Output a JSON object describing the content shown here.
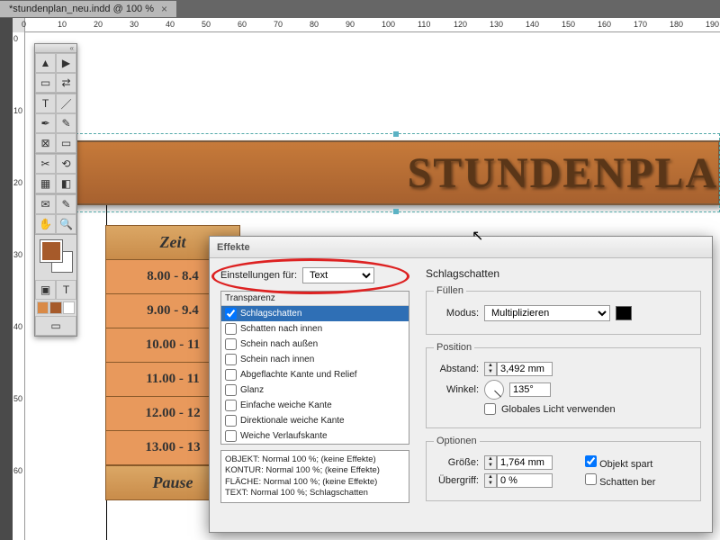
{
  "tab": {
    "title": "*stundenplan_neu.indd @ 100 %",
    "close": "×"
  },
  "ruler_top": [
    "0",
    "10",
    "20",
    "30",
    "40",
    "50",
    "60",
    "70",
    "80",
    "90",
    "100",
    "110",
    "120",
    "130",
    "140",
    "150",
    "160",
    "170",
    "180",
    "190"
  ],
  "ruler_left": [
    "0",
    "10",
    "20",
    "30",
    "40",
    "50",
    "60"
  ],
  "banner_text": "STUNDENPLA",
  "schedule": {
    "header": "Zeit",
    "rows": [
      "8.00 - 8.4",
      "9.00 - 9.4",
      "10.00 - 11",
      "11.00 - 11",
      "12.00 - 12",
      "13.00 - 13"
    ],
    "pause": "Pause"
  },
  "dialog": {
    "title": "Effekte",
    "settings_for_label": "Einstellungen für:",
    "settings_for_value": "Text",
    "list_header": "Transparenz",
    "list": [
      {
        "label": "Schlagschatten",
        "checked": true,
        "selected": true
      },
      {
        "label": "Schatten nach innen",
        "checked": false
      },
      {
        "label": "Schein nach außen",
        "checked": false
      },
      {
        "label": "Schein nach innen",
        "checked": false
      },
      {
        "label": "Abgeflachte Kante und Relief",
        "checked": false
      },
      {
        "label": "Glanz",
        "checked": false
      },
      {
        "label": "Einfache weiche Kante",
        "checked": false
      },
      {
        "label": "Direktionale weiche Kante",
        "checked": false
      },
      {
        "label": "Weiche Verlaufskante",
        "checked": false
      }
    ],
    "summary": [
      "OBJEKT: Normal 100 %; (keine Effekte)",
      "KONTUR: Normal 100 %; (keine Effekte)",
      "FLÄCHE: Normal 100 %; (keine Effekte)",
      "TEXT: Normal 100 %; Schlagschatten"
    ],
    "drop_shadow_title": "Schlagschatten",
    "blend": {
      "legend": "Füllen",
      "mode_label": "Modus:",
      "mode_value": "Multiplizieren"
    },
    "position": {
      "legend": "Position",
      "distance_label": "Abstand:",
      "distance_value": "3,492 mm",
      "angle_label": "Winkel:",
      "angle_value": "135°",
      "global_light": "Globales Licht verwenden"
    },
    "options": {
      "legend": "Optionen",
      "size_label": "Größe:",
      "size_value": "1,764 mm",
      "spread_label": "Übergriff:",
      "spread_value": "0 %",
      "obj_spart": "Objekt spart",
      "schatten_ber": "Schatten ber"
    }
  }
}
